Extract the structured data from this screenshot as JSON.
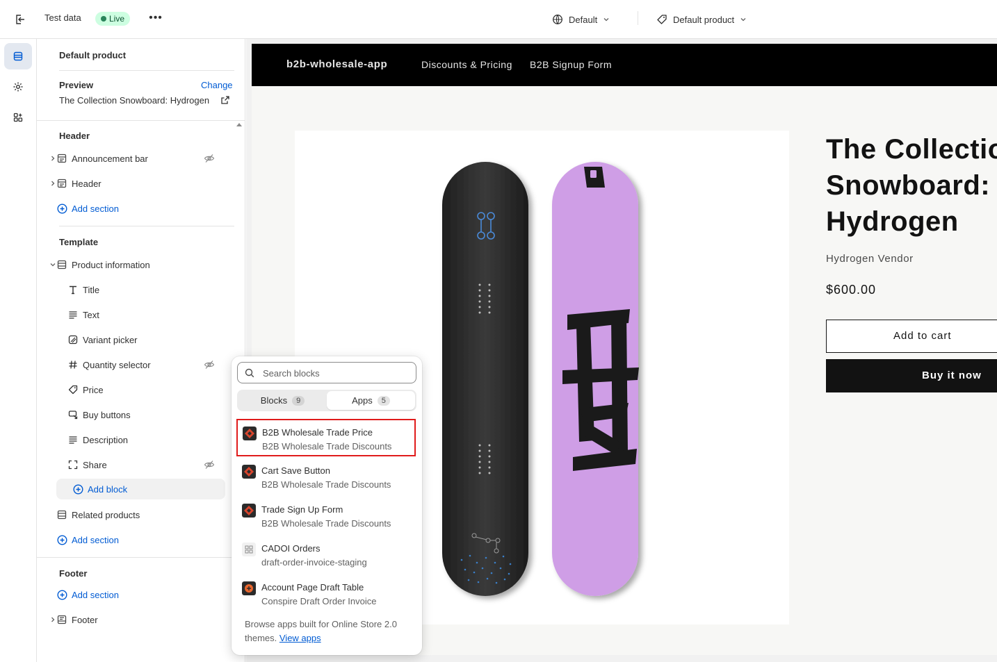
{
  "topbar": {
    "title": "Test data",
    "live_badge": "Live",
    "more_label": "•••",
    "theme_selector": "Default",
    "template_selector": "Default product"
  },
  "rail": {
    "items": [
      {
        "name": "sections-icon",
        "active": true
      },
      {
        "name": "settings-icon",
        "active": false
      },
      {
        "name": "apps-icon",
        "active": false
      }
    ]
  },
  "sidebar": {
    "title": "Default product",
    "preview": {
      "label": "Preview",
      "change": "Change",
      "value": "The Collection Snowboard: Hydrogen"
    },
    "header_group": {
      "title": "Header",
      "items": [
        {
          "label": "Announcement bar",
          "hidden": true
        },
        {
          "label": "Header",
          "hidden": false
        }
      ],
      "add_section": "Add section"
    },
    "template_group": {
      "title": "Template",
      "section": "Product information",
      "blocks": [
        {
          "label": "Title",
          "icon": "text-title-icon",
          "hidden": false
        },
        {
          "label": "Text",
          "icon": "text-lines-icon",
          "hidden": false
        },
        {
          "label": "Variant picker",
          "icon": "variant-icon",
          "hidden": false
        },
        {
          "label": "Quantity selector",
          "icon": "hash-icon",
          "hidden": true
        },
        {
          "label": "Price",
          "icon": "price-tag-icon",
          "hidden": false
        },
        {
          "label": "Buy buttons",
          "icon": "cart-icon",
          "hidden": false
        },
        {
          "label": "Description",
          "icon": "text-lines-icon",
          "hidden": false
        },
        {
          "label": "Share",
          "icon": "share-icon",
          "hidden": true
        }
      ],
      "add_block": "Add block",
      "related": "Related products",
      "add_section": "Add section"
    },
    "footer_group": {
      "title": "Footer",
      "add_section": "Add section",
      "footer": "Footer"
    }
  },
  "store": {
    "brand": "b2b-wholesale-app",
    "nav": [
      "Discounts & Pricing",
      "B2B Signup Form"
    ],
    "product_title": "The Collection Snowboard: Hydrogen",
    "vendor": "Hydrogen Vendor",
    "price": "$600.00",
    "add_to_cart": "Add to cart",
    "buy_now": "Buy it now",
    "board_colors": {
      "dark": "#2b2b2b",
      "purple": "#cf9ee6"
    }
  },
  "popover": {
    "search_placeholder": "Search blocks",
    "tabs": [
      {
        "label": "Blocks",
        "count": "9"
      },
      {
        "label": "Apps",
        "count": "5"
      }
    ],
    "apps": [
      {
        "name": "B2B Wholesale Trade Price",
        "sub": "B2B Wholesale Trade Discounts",
        "selected": true
      },
      {
        "name": "Cart Save Button",
        "sub": "B2B Wholesale Trade Discounts",
        "selected": false
      },
      {
        "name": "Trade Sign Up Form",
        "sub": "B2B Wholesale Trade Discounts",
        "selected": false
      },
      {
        "name": "CADOI Orders",
        "sub": "draft-order-invoice-staging",
        "selected": false
      },
      {
        "name": "Account Page Draft Table",
        "sub": "Conspire Draft Order Invoice",
        "selected": false
      }
    ],
    "footnote": "Browse apps built for Online Store 2.0 themes.",
    "footnote_link": "View apps"
  },
  "colors": {
    "accent": "#005bd3",
    "live_bg": "#cdfee1",
    "highlight": "#e01b1b"
  }
}
